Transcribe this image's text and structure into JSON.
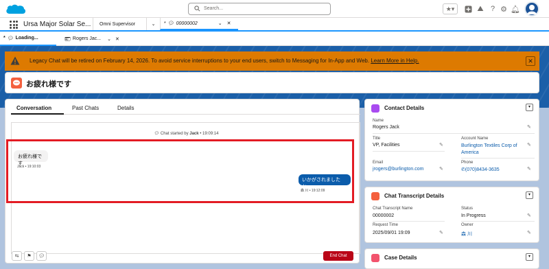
{
  "topbar": {
    "search_placeholder": "Search..."
  },
  "nav": {
    "app_name": "Ursa Major Solar Se...",
    "tabs": [
      {
        "label": "Omni Supervisor"
      },
      {
        "label": "00000002",
        "prefix": "*"
      }
    ]
  },
  "subtabs": [
    {
      "label": "Loading...",
      "prefix": "*"
    },
    {
      "label": "Rogers Jac..."
    }
  ],
  "banner": {
    "text": "Legacy Chat will be retired on February 14, 2026. To avoid service interruptions to your end users, switch to Messaging for In-App and Web.",
    "link": "Learn More in Help."
  },
  "header": {
    "title": "お疲れ様です"
  },
  "conversation": {
    "tabs": [
      "Conversation",
      "Past Chats",
      "Details"
    ],
    "started_prefix": "Chat started by",
    "started_by": "Jack",
    "started_time": "• 19:09:14",
    "messages": [
      {
        "text": "お疲れ様です",
        "meta": "Jack • 19:10:03",
        "direction": "in"
      },
      {
        "text": "いかがされましたか。",
        "meta": "森 川 • 19:12:09",
        "direction": "out"
      }
    ],
    "end_chat": "End Chat"
  },
  "contact": {
    "title": "Contact Details",
    "name_label": "Name",
    "name": "Rogers Jack",
    "title_label": "Title",
    "title_value": "VP, Facilities",
    "account_label": "Account Name",
    "account_line1": "Burlington Textiles Corp of",
    "account_line2": "America",
    "email_label": "Email",
    "email": "jrogers@burlington.com",
    "phone_label": "Phone",
    "phone": "(070)8434-3635"
  },
  "transcript": {
    "title": "Chat Transcript Details",
    "name_label": "Chat Transcript Name",
    "name": "00000002",
    "status_label": "Status",
    "status": "In Progress",
    "request_label": "Request Time",
    "request_time": "2025/09/01 19:09",
    "owner_label": "Owner",
    "owner": "森 川"
  },
  "case": {
    "title": "Case Details"
  },
  "colors": {
    "accent": "#0b5cab",
    "banner": "#dd7a01",
    "highlight": "#e31b23",
    "end_chat": "#ba0517"
  }
}
